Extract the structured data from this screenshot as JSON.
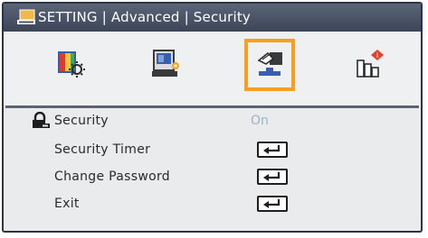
{
  "title": {
    "text": "SETTING | Advanced | Security",
    "icon": "settings-icon"
  },
  "tabs": [
    {
      "name": "color-settings-icon",
      "active": false
    },
    {
      "name": "display-settings-icon",
      "active": false
    },
    {
      "name": "security-settings-icon",
      "active": true
    },
    {
      "name": "system-info-icon",
      "active": false
    }
  ],
  "menu": {
    "security": {
      "label": "Security",
      "value": "On",
      "icon": "lock-icon"
    },
    "security_timer": {
      "label": "Security Timer",
      "action": "enter-icon"
    },
    "change_password": {
      "label": "Change Password",
      "action": "enter-icon"
    },
    "exit": {
      "label": "Exit",
      "action": "enter-icon"
    }
  },
  "colors": {
    "accent": "#f5a020",
    "title_bar": "#4b5467",
    "value_text": "#9ab3c6"
  }
}
